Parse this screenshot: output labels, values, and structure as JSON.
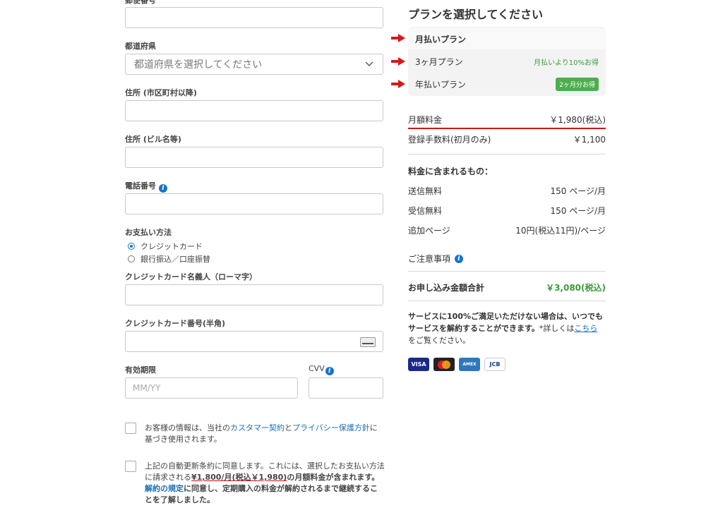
{
  "form": {
    "postal_label": "郵便番号",
    "prefecture_label": "都道府県",
    "prefecture_value": "都道府県を選択してください",
    "address1_label": "住所 (市区町村以降)",
    "address2_label": "住所 (ビル名等)",
    "phone_label": "電話番号",
    "payment_label": "お支払い方法",
    "payment_options": [
      {
        "label": "クレジットカード",
        "selected": true
      },
      {
        "label": "銀行振込／口座振替",
        "selected": false
      }
    ],
    "card_name_label": "クレジットカード名義人（ローマ字）",
    "card_number_label": "クレジットカード番号(半角)",
    "expiry_label": "有効期限",
    "expiry_placeholder": "MM/YY",
    "cvv_label": "CVV",
    "agree1": {
      "pre": "お客様の情報は、当社の",
      "link1": "カスタマー契約",
      "mid": "と",
      "link2": "プライバシー保護方針",
      "post": "に基づき使用されます。"
    },
    "agree2": {
      "pre": "上記の自動更新条約に同意します。これには、選択したお支払い方法に請求される",
      "price": "¥1,800/月(税込￥1,980)",
      "post": "の月額料金が含まれます。",
      "link": "解約の規定",
      "tail": "に同意し、定期購入の料金が解約されるまで継続することを了解しました。"
    }
  },
  "plan": {
    "title": "プランを選択してください",
    "options": [
      {
        "label": "月払いプラン",
        "note": "",
        "badge": ""
      },
      {
        "label": "3ヶ月プラン",
        "note": "月払いより10%お得",
        "badge": ""
      },
      {
        "label": "年払いプラン",
        "note": "",
        "badge": "2ヶ月分お得"
      }
    ],
    "monthly_label": "月額料金",
    "monthly_value": "￥1,980(税込)",
    "fee_label": "登録手数料(初月のみ)",
    "fee_value": "￥1,100",
    "includes_title": "料金に含まれるもの：",
    "includes": [
      {
        "label": "送信無料",
        "value": "150 ページ/月"
      },
      {
        "label": "受信無料",
        "value": "150 ページ/月"
      },
      {
        "label": "追加ページ",
        "value": "10円(税込11円)/ページ"
      }
    ],
    "notes_label": "ご注意事項",
    "total_label": "お申し込み金額合計",
    "total_value": "￥3,080(税込)",
    "satisfaction_bold": "サービスに100%ご満足いただけない場合は、いつでもサービスを解約することができます。",
    "satisfaction_pre": "*詳しくは",
    "satisfaction_link": "こちら",
    "satisfaction_post": "をご覧ください。",
    "cards": [
      "VISA",
      "mastercard-icon",
      "AMEX",
      "JCB"
    ]
  },
  "colors": {
    "accent_blue": "#1a73c9",
    "accent_red": "#c81818",
    "accent_green": "#3a9a3a"
  }
}
